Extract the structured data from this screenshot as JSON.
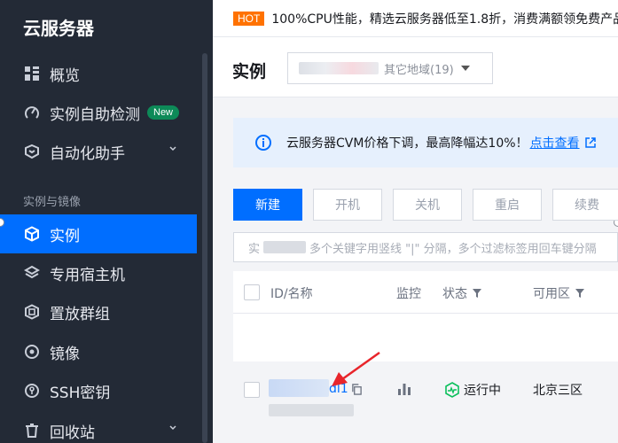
{
  "sidebar": {
    "title": "云服务器",
    "section_label": "实例与镜像",
    "items": [
      {
        "label": "概览",
        "icon": "grid-icon"
      },
      {
        "label": "实例自助检测",
        "icon": "gauge-icon",
        "badge": "New"
      },
      {
        "label": "自动化助手",
        "icon": "robot-icon"
      },
      {
        "label": "实例",
        "icon": "cube-icon",
        "active": true
      },
      {
        "label": "专用宿主机",
        "icon": "layers-icon"
      },
      {
        "label": "置放群组",
        "icon": "group-icon"
      },
      {
        "label": "镜像",
        "icon": "disc-icon"
      },
      {
        "label": "SSH密钥",
        "icon": "key-icon"
      },
      {
        "label": "回收站",
        "icon": "trash-icon"
      }
    ]
  },
  "banner": {
    "tag": "HOT",
    "text": "100%CPU性能，精选云服务器低至1.8折，消费满额领免费产品"
  },
  "header": {
    "title": "实例",
    "region_suffix": "其它地域(19)"
  },
  "notice": {
    "text": "云服务器CVM价格下调，最高降幅达10%！",
    "link": "点击查看"
  },
  "toolbar": {
    "new": "新建",
    "start": "开机",
    "shutdown": "关机",
    "restart": "重启",
    "renew": "续费"
  },
  "search": {
    "prefix": "实",
    "hint": "多个关键字用竖线 \"|\" 分隔，多个过滤标签用回车键分隔"
  },
  "table": {
    "columns": {
      "id_name": "ID/名称",
      "monitor": "监控",
      "status": "状态",
      "zone": "可用区"
    },
    "row": {
      "id_suffix": "dl1",
      "status": "运行中",
      "zone": "北京三区"
    }
  },
  "colors": {
    "sidebar_bg": "#232a36",
    "accent": "#006eff",
    "running": "#0abf5b",
    "hot": "#ff7200",
    "annotation_arrow": "#e8252b"
  }
}
